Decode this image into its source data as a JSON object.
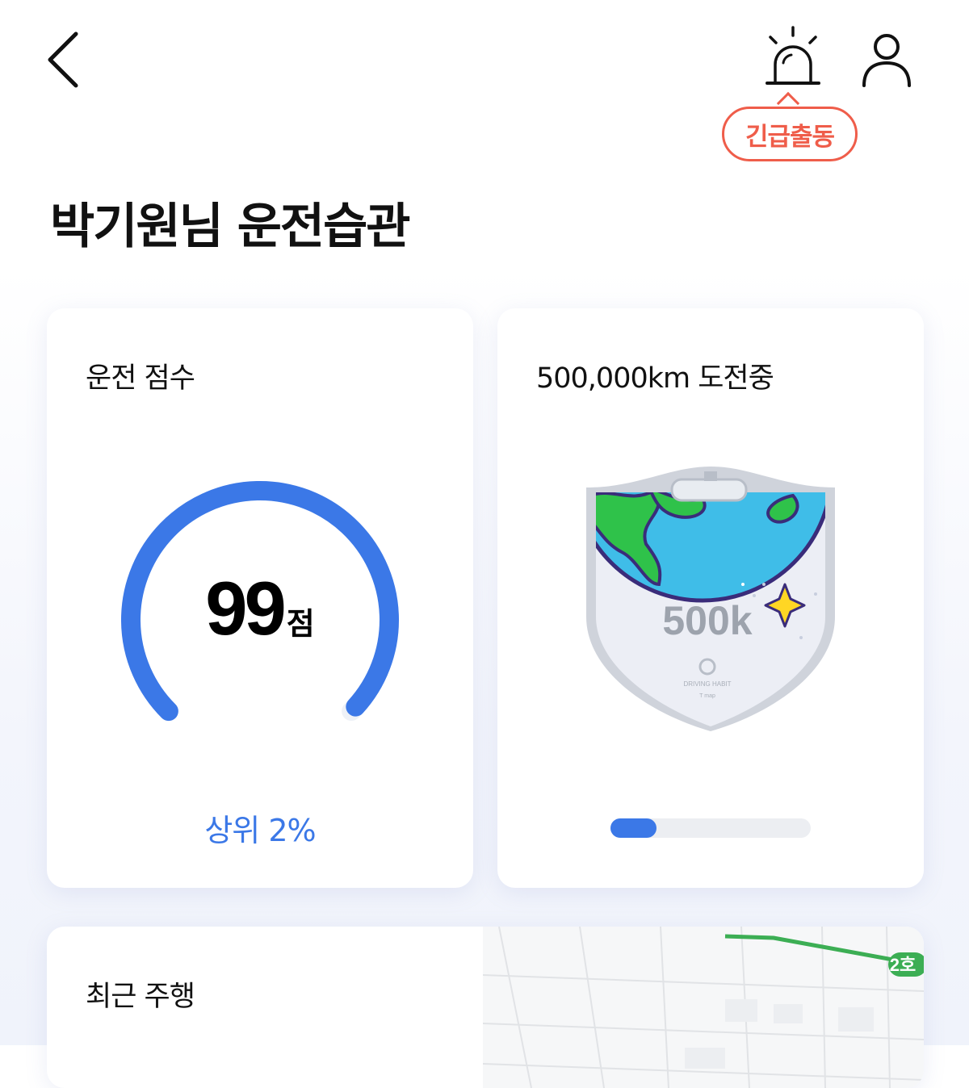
{
  "header": {
    "emergency_label": "긴급출동"
  },
  "page_title": "박기원님 운전습관",
  "score_card": {
    "title": "운전 점수",
    "score": "99",
    "unit": "점",
    "rank": "상위 2%",
    "gauge_fraction": 0.99,
    "gauge_color": "#3b78e7"
  },
  "challenge_card": {
    "title": "500,000km 도전중",
    "badge_text": "500k",
    "badge_caption": "DRIVING HABIT",
    "badge_subcaption": "T map",
    "progress_fraction": 0.23,
    "progress_color": "#3b78e7"
  },
  "recent_card": {
    "title": "최근 주행",
    "map_label": "2호"
  },
  "colors": {
    "accent": "#3b78e7",
    "emergency": "#ef5d4a"
  }
}
